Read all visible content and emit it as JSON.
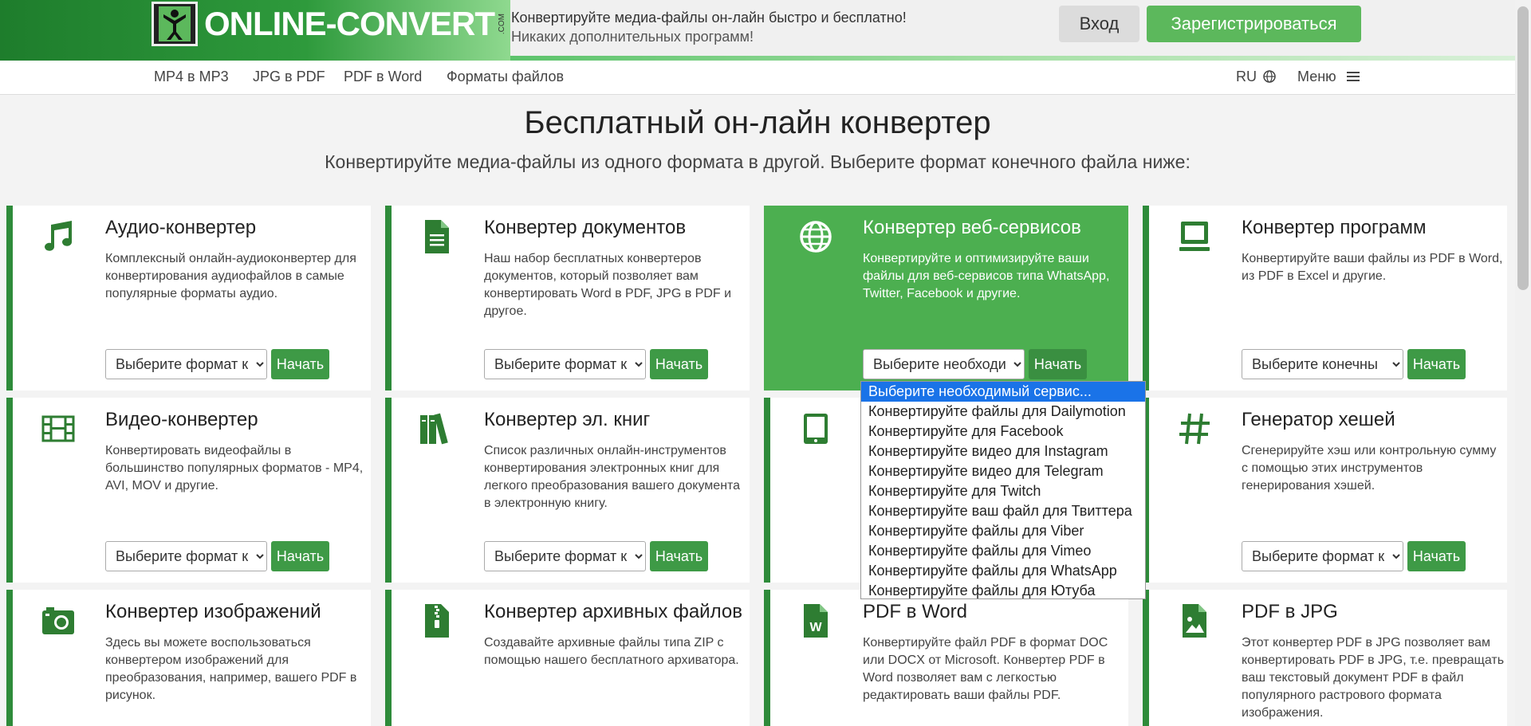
{
  "header": {
    "logo_text": "ONLINE-CONVERT",
    "logo_com": ".COM",
    "tagline_main": "Конвертируйте медиа-файлы он-лайн быстро и бесплатно!",
    "tagline_sub": "Никаких дополнительных программ!",
    "login_label": "Вход",
    "register_label": "Зарегистрироваться"
  },
  "nav": {
    "links": [
      "MP4 в MP3",
      "JPG в PDF",
      "PDF в Word",
      "Форматы файлов"
    ],
    "lang": "RU",
    "menu_label": "Меню"
  },
  "hero": {
    "title": "Бесплатный он-лайн конвертер",
    "subtitle": "Конвертируйте медиа-файлы из одного формата в другой. Выберите формат конечного файла ниже:"
  },
  "cards": [
    {
      "title": "Аудио-конвертер",
      "desc": "Комплексный онлайн-аудиоконвертер для конвертирования аудиофайлов в самые популярные форматы аудио.",
      "select": "Выберите формат к",
      "button": "Начать",
      "icon": "music-note-icon"
    },
    {
      "title": "Конвертер документов",
      "desc": "Наш набор бесплатных конвертеров документов, который позволяет вам конвертировать Word в PDF, JPG в PDF и другое.",
      "select": "Выберите формат к",
      "button": "Начать",
      "icon": "document-icon"
    },
    {
      "title": "Конвертер веб-сервисов",
      "desc": "Конвертируйте и оптимизируйте ваши файлы для веб-сервисов типа WhatsApp, Twitter, Facebook и другие.",
      "select": "Выберите необходи",
      "button": "Начать",
      "icon": "globe-icon"
    },
    {
      "title": "Конвертер программ",
      "desc": "Конвертируйте ваши файлы из PDF в Word, из PDF в Excel и другие.",
      "select": "Выберите конечны",
      "button": "Начать",
      "icon": "monitor-icon"
    },
    {
      "title": "Видео-конвертер",
      "desc": "Конвертировать видеофайлы в большинство популярных форматов - MP4, AVI, MOV и другие.",
      "select": "Выберите формат к",
      "button": "Начать",
      "icon": "film-icon"
    },
    {
      "title": "Конвертер эл. книг",
      "desc": "Список различных онлайн-инструментов конвертирования электронных книг для легкого преобразования вашего документа в электронную книгу.",
      "select": "Выберите формат к",
      "button": "Начать",
      "icon": "books-icon"
    },
    {
      "title": "",
      "desc": "",
      "select": "",
      "button": "",
      "icon": "tablet-icon"
    },
    {
      "title": "Генератор хешей",
      "desc": "Сгенерируйте хэш или контрольную сумму с помощью этих инструментов генерирования хэшей.",
      "select": "Выберите формат к",
      "button": "Начать",
      "icon": "hash-icon"
    },
    {
      "title": "Конвертер изображений",
      "desc": "Здесь вы можете воспользоваться конвертером изображений для преобразования, например, вашего PDF в рисунок.",
      "icon": "camera-icon"
    },
    {
      "title": "Конвертер архивных файлов",
      "desc": "Создавайте архивные файлы типа ZIP с помощью нашего бесплатного архиватора.",
      "icon": "archive-icon"
    },
    {
      "title": "PDF в Word",
      "desc": "Конвертируйте файл PDF в формат DOC или DOCX от Microsoft. Конвертер PDF в Word позволяет вам с легкостью редактировать ваши файлы PDF.",
      "icon": "word-file-icon"
    },
    {
      "title": "PDF в JPG",
      "desc": "Этот конвертер PDF в JPG позволяет вам конвертировать PDF в JPG, т.е. превращать ваш текстовый документ PDF в файл популярного растрового формата изображения.",
      "icon": "image-file-icon"
    }
  ],
  "dropdown": {
    "options": [
      "Выберите необходимый сервис...",
      "Конвертируйте файлы для Dailymotion",
      "Конвертируйте для Facebook",
      "Конвертируйте видео для Instagram",
      "Конвертируйте видео для Telegram",
      "Конвертируйте для Twitch",
      "Конвертируйте ваш файл для Твиттера",
      "Конвертируйте файлы для Viber",
      "Конвертируйте файлы для Vimeo",
      "Конвертируйте файлы для WhatsApp",
      "Конвертируйте файлы для Ютуба"
    ]
  },
  "colors": {
    "brand_green": "#2e8b3a",
    "button_green": "#5cb85c",
    "active_card": "#4caf50",
    "selected_option": "#1a73e8"
  }
}
